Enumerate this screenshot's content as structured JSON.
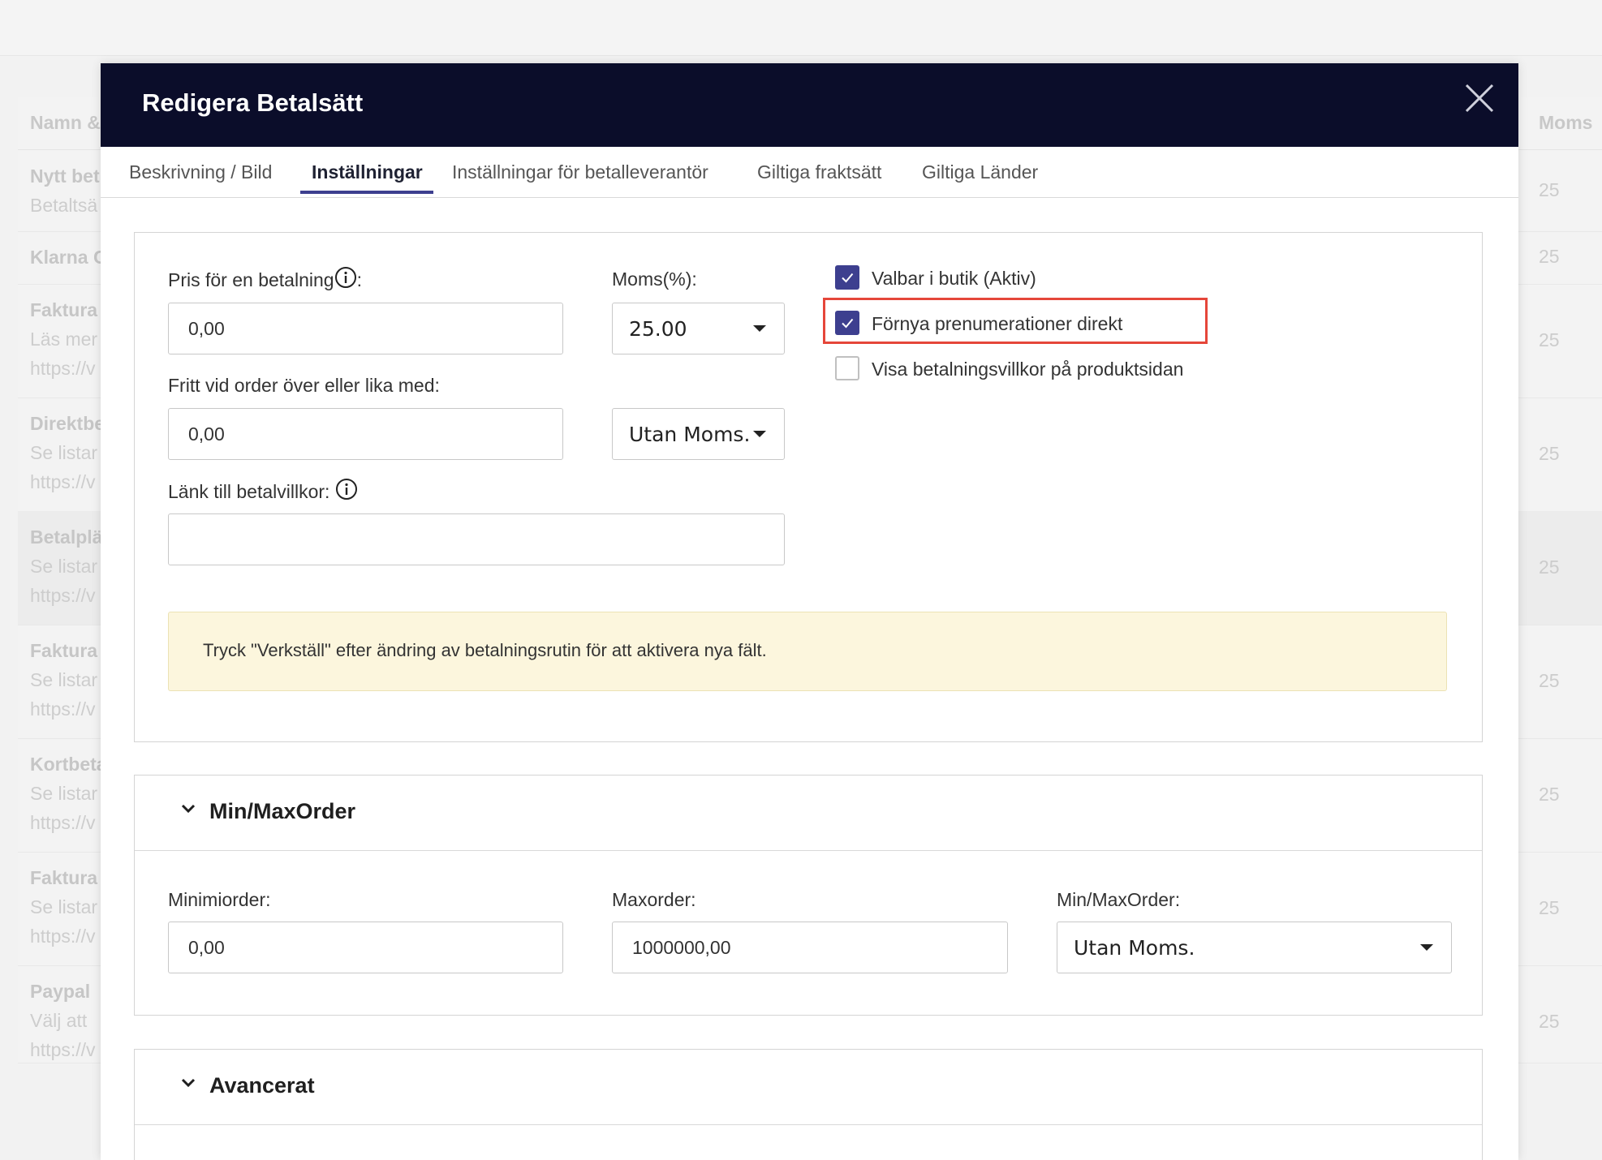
{
  "background": {
    "column_name_header": "Namn &",
    "column_vat_header": "Moms",
    "rows": [
      {
        "title": "Nytt bet",
        "lines": [
          "Betaltsä"
        ],
        "vat": "25"
      },
      {
        "title": "Klarna C",
        "lines": [],
        "vat": "25"
      },
      {
        "title": "Faktura",
        "lines": [
          "Läs mer",
          "https://v"
        ],
        "vat": "25"
      },
      {
        "title": "Direktbe",
        "lines": [
          "Se listar",
          "https://v"
        ],
        "vat": "25"
      },
      {
        "title": "Betalplä",
        "lines": [
          "Se listar",
          "https://v"
        ],
        "vat": "25"
      },
      {
        "title": "Faktura",
        "lines": [
          "Se listar",
          "https://v"
        ],
        "vat": "25"
      },
      {
        "title": "Kortbeta",
        "lines": [
          "Se listar",
          "https://v"
        ],
        "vat": "25"
      },
      {
        "title": "Faktura",
        "lines": [
          "Se listar",
          "https://v"
        ],
        "vat": "25"
      },
      {
        "title": "Paypal",
        "lines": [
          "Välj att",
          "https://v"
        ],
        "vat": "25"
      }
    ]
  },
  "modal": {
    "title": "Redigera Betalsätt",
    "close_icon": "close-icon",
    "tabs": [
      {
        "label": "Beskrivning / Bild",
        "active": false
      },
      {
        "label": "Inställningar",
        "active": true
      },
      {
        "label": "Inställningar för betalleverantör",
        "active": false
      },
      {
        "label": "Giltiga fraktsätt",
        "active": false
      },
      {
        "label": "Giltiga Länder",
        "active": false
      }
    ]
  },
  "settings": {
    "price_label": "Pris för en betalning",
    "price_label_suffix": ":",
    "price_value": "0,00",
    "vat_label": "Moms(%):",
    "vat_value": "25.00",
    "free_label": "Fritt vid order över eller lika med:",
    "free_value": "0,00",
    "free_vat_mode": "Utan Moms.",
    "terms_link_label": "Länk till betalvillkor:",
    "terms_link_value": "",
    "checkboxes": [
      {
        "label": "Valbar i butik (Aktiv)",
        "checked": true
      },
      {
        "label": "Förnya prenumerationer direkt",
        "checked": true
      },
      {
        "label": "Visa betalningsvillkor på produktsidan",
        "checked": false
      }
    ],
    "notice": "Tryck \"Verkställ\" efter ändring av betalningsrutin för att aktivera nya fält."
  },
  "minmax": {
    "title": "Min/MaxOrder",
    "min_label": "Minimiorder:",
    "min_value": "0,00",
    "max_label": "Maxorder:",
    "max_value": "1000000,00",
    "mode_label": "Min/MaxOrder:",
    "mode_value": "Utan Moms."
  },
  "advanced": {
    "title": "Avancerat"
  },
  "colors": {
    "header_bg": "#0b0d2a",
    "accent": "#3d3f8f",
    "highlight": "#e5463a",
    "notice_bg": "#fcf6dd"
  }
}
